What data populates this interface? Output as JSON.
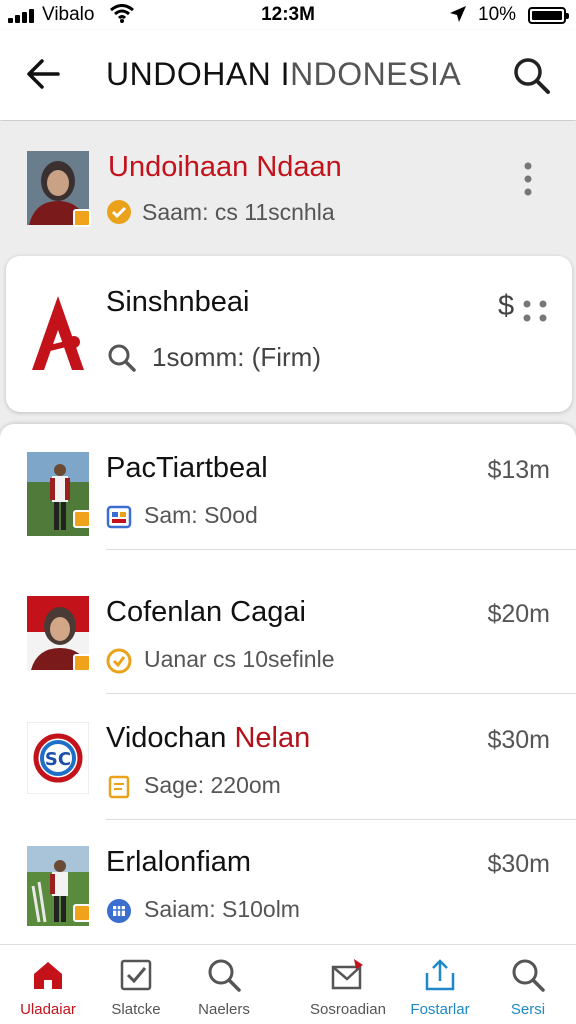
{
  "status_bar": {
    "carrier": "Vibalo",
    "time": "12:3M",
    "battery": "10%"
  },
  "header": {
    "title_bold": "UNDOHAN I",
    "title_rest": "NDONESIA"
  },
  "top_item": {
    "name": "Undoihaan Ndaan",
    "meta": "Saam: cs 11scnhla"
  },
  "featured": {
    "name": "Sinshnbeai",
    "meta": "1somm:  (Firm)",
    "price": "$"
  },
  "items": [
    {
      "name": "PacTiartbeal",
      "name_red": "",
      "price": "$13m",
      "meta": "Sam: S0od",
      "badge_color": "#f0a21a",
      "meta_icon_color": "#3a6fcf"
    },
    {
      "name": "Cofenlan Cagai",
      "name_red": "",
      "price": "$20m",
      "meta": "Uanar cs 10sefinle",
      "badge_color": "#f0a21a",
      "meta_icon_color": "#e9a21a"
    },
    {
      "name": "Vidochan ",
      "name_red": "Nelan",
      "price": "$30m",
      "meta": "Sage: 220om",
      "badge_color": "#f0a21a",
      "meta_icon_color": "#e9a21a"
    },
    {
      "name": "Erlalonfiam",
      "name_red": "",
      "price": "$30m",
      "meta": "Saiam: S10olm",
      "badge_color": "#f0a21a",
      "meta_icon_color": "#3a6fcf"
    }
  ],
  "nav": [
    {
      "label": "Uladaiar",
      "color": "#c4121b"
    },
    {
      "label": "Slatcke",
      "color": "#555555"
    },
    {
      "label": "Naelers",
      "color": "#555555"
    },
    {
      "label": "Sosroadian",
      "color": "#555555"
    },
    {
      "label": "Fostarlar",
      "color": "#1e88c8"
    },
    {
      "label": "Sersi",
      "color": "#1e88c8"
    }
  ],
  "colors": {
    "accent": "#c4121b",
    "link": "#1e88c8",
    "badge": "#f0a21a"
  }
}
